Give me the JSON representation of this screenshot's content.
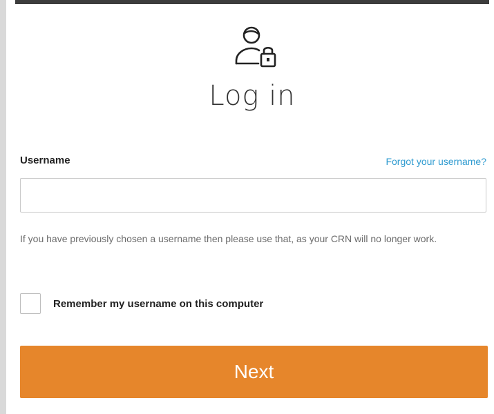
{
  "header": {
    "icon": "user-lock-icon",
    "title": "Log in"
  },
  "form": {
    "username_label": "Username",
    "forgot_link": "Forgot your username?",
    "username_value": "",
    "username_placeholder": "",
    "help_text": "If you have previously chosen a username then please use that, as your CRN will no longer work.",
    "remember_label": "Remember my username on this computer",
    "remember_checked": false,
    "next_label": "Next"
  },
  "colors": {
    "accent": "#e6862b",
    "link": "#2f9bd0",
    "top_bar": "#3d3d3d"
  }
}
